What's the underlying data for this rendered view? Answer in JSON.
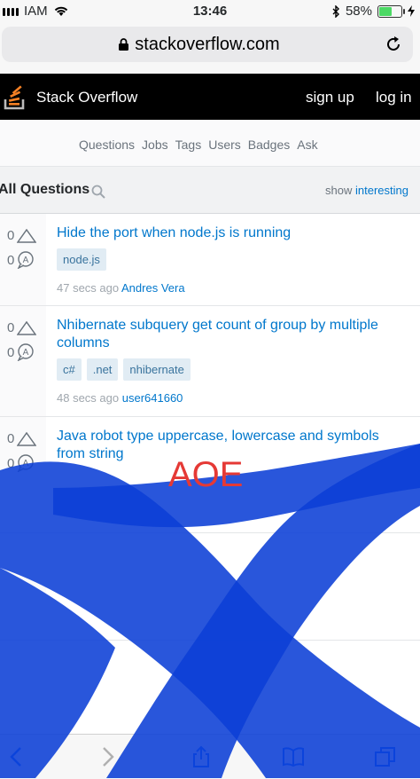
{
  "status_bar": {
    "carrier": "IAM",
    "time": "13:46",
    "battery": "58%",
    "battery_level": 0.58
  },
  "url_bar": {
    "host": "stackoverflow.com"
  },
  "header": {
    "brand": "Stack Overflow",
    "sign_up": "sign up",
    "log_in": "log in"
  },
  "nav": {
    "items": [
      "Questions",
      "Jobs",
      "Tags",
      "Users",
      "Badges",
      "Ask"
    ]
  },
  "page": {
    "title": "All Questions",
    "show_label": "show",
    "show_filter": "interesting"
  },
  "questions": [
    {
      "votes": "0",
      "answers": "0",
      "title": "Hide the port when node.js is running",
      "tags": [
        "node.js"
      ],
      "time": "47 secs ago",
      "user": "Andres Vera"
    },
    {
      "votes": "0",
      "answers": "0",
      "title": "Nhibernate subquery get count of group by multiple columns",
      "tags": [
        "c#",
        ".net",
        "nhibernate"
      ],
      "time": "48 secs ago",
      "user": "user641660"
    },
    {
      "votes": "0",
      "answers": "0",
      "title": "Java robot type uppercase, lowercase and symbols from string",
      "tags": [],
      "time": "",
      "user": ""
    }
  ],
  "annotation": {
    "text": "AOE",
    "color": "#e53935",
    "scribble_color": "#0b3fd6"
  },
  "colors": {
    "link": "#0077cc",
    "brand_orange": "#f48024",
    "tag_bg": "#e1ecf4"
  }
}
